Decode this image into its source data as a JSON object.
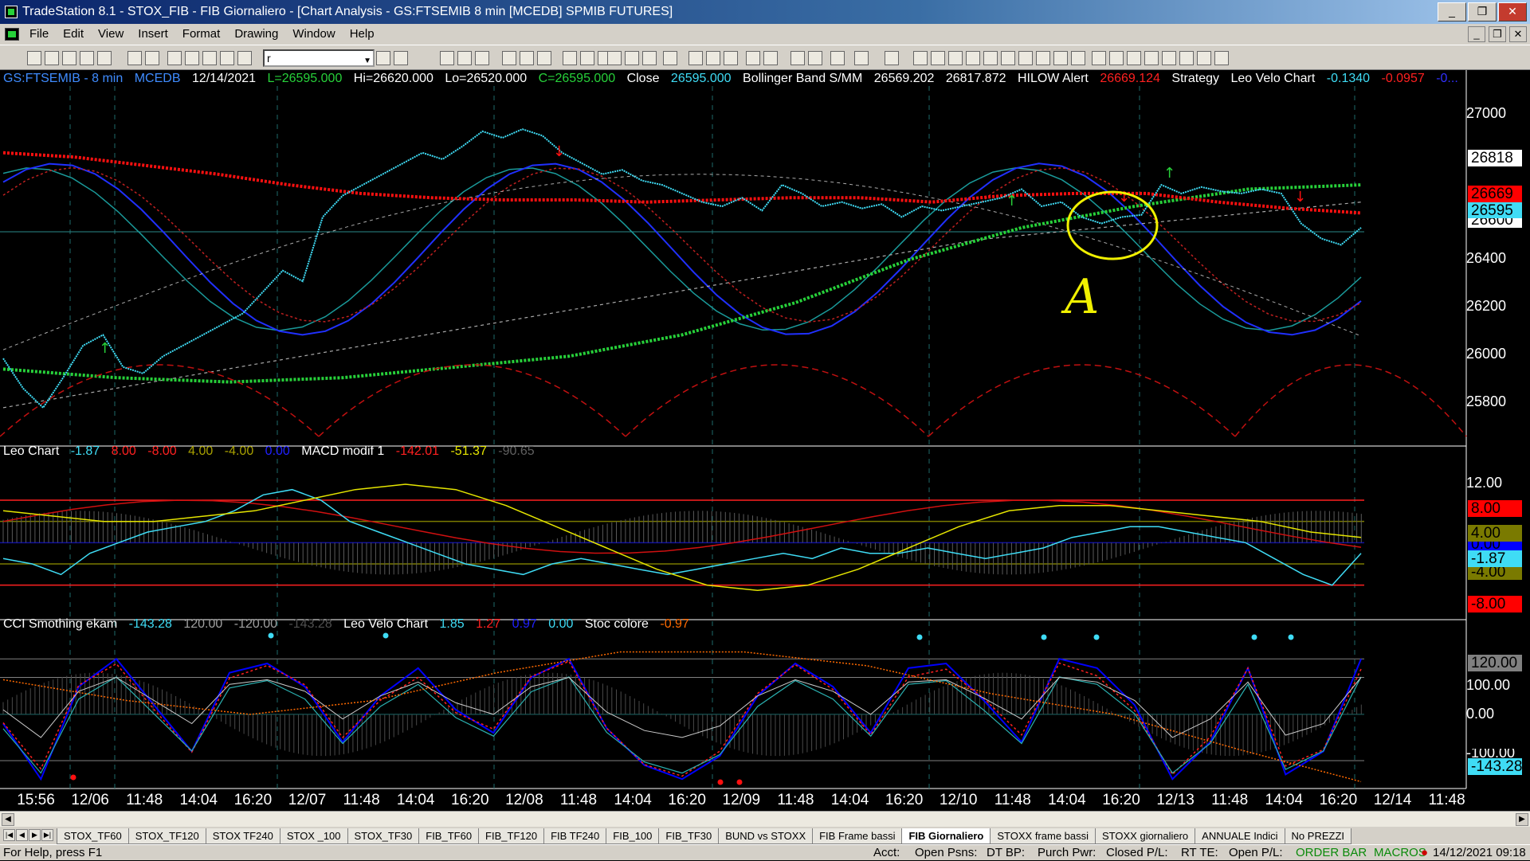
{
  "window": {
    "title": "TradeStation 8.1 - STOX_FIB - FIB Giornaliero - [Chart Analysis - GS:FTSEMIB  8 min  [MCEDB] SPMIB FUTURES]",
    "controls": [
      "_",
      "❐",
      "✕"
    ]
  },
  "menu": [
    "File",
    "Edit",
    "View",
    "Insert",
    "Format",
    "Drawing",
    "Window",
    "Help"
  ],
  "mdi_controls": [
    "_",
    "❐",
    "✕"
  ],
  "toolbar": {
    "symbol_combo_value": "r"
  },
  "panel1": {
    "symbol": "GS:FTSEMIB - 8 min",
    "source": "MCEDB",
    "date": "12/14/2021",
    "low_label": "L=26595.000",
    "high_label": "Hi=26620.000",
    "lo_label": "Lo=26520.000",
    "close_label": "C=26595.000",
    "close_word": "Close",
    "close_value": "26595.000",
    "bb_name": "Bollinger Band S/MM",
    "bb_v1": "26569.202",
    "bb_v2": "26817.872",
    "hilow_name": "HILOW Alert",
    "hilow_value": "26669.124",
    "strategy": "Strategy",
    "velo_name": "Leo Velo Chart",
    "velo_v1": "-0.1340",
    "velo_v2": "-0.0957",
    "velo_more": "-0...",
    "scale": [
      "27000",
      "26400",
      "26200",
      "26000",
      "25800"
    ],
    "badges": [
      {
        "text": "26818",
        "bg": "#ffffff",
        "fg": "#000000"
      },
      {
        "text": "26669",
        "bg": "#ff0000",
        "fg": "#000000"
      },
      {
        "text": "26595",
        "bg": "#3fdcf5",
        "fg": "#000000"
      },
      {
        "text": "26600",
        "bg": "#ffffff",
        "fg": "#000000"
      }
    ],
    "annotation": "A"
  },
  "panel2": {
    "name": "Leo Chart",
    "v1": "-1.87",
    "v2": "8.00",
    "v3": "-8.00",
    "v4": "4.00",
    "v5": "-4.00",
    "v6": "0.00",
    "macd_name": "MACD modif 1",
    "m1": "-142.01",
    "m2": "-51.37",
    "m3": "-90.65",
    "scale": [
      "12.00"
    ],
    "badges": [
      {
        "text": "8.00",
        "bg": "#ff0000",
        "fg": "#000000"
      },
      {
        "text": "4.00",
        "bg": "#7a7a00",
        "fg": "#000000"
      },
      {
        "text": "0.00",
        "bg": "#0000ff",
        "fg": "#000000"
      },
      {
        "text": "-1.87",
        "bg": "#3fdcf5",
        "fg": "#000000"
      },
      {
        "text": "-4.00",
        "bg": "#7a7a00",
        "fg": "#000000"
      },
      {
        "text": "-8.00",
        "bg": "#ff0000",
        "fg": "#000000"
      }
    ]
  },
  "panel3": {
    "cci_name": "CCI Smothing ekam",
    "c1": "-143.28",
    "c2": "120.00",
    "c3": "-120.00",
    "c4": "-143.28",
    "velo_name": "Leo Velo Chart",
    "v1": "1.85",
    "v2": "1.27",
    "v3": "0.97",
    "v4": "0.00",
    "stoc_name": "Stoc colore",
    "s1": "-0.97",
    "scale": [
      "100.00",
      "0.00",
      "-100.00"
    ],
    "badges": [
      {
        "text": "120.00",
        "bg": "#808080",
        "fg": "#000000"
      },
      {
        "text": "-143.28",
        "bg": "#3fdcf5",
        "fg": "#000000"
      }
    ]
  },
  "xaxis": [
    "15:56",
    "12/06",
    "11:48",
    "14:04",
    "16:20",
    "12/07",
    "11:48",
    "14:04",
    "16:20",
    "12/08",
    "11:48",
    "14:04",
    "16:20",
    "12/09",
    "11:48",
    "14:04",
    "16:20",
    "12/10",
    "11:48",
    "14:04",
    "16:20",
    "12/13",
    "11:48",
    "14:04",
    "16:20",
    "12/14",
    "11:48"
  ],
  "tabs": [
    "STOX_TF60",
    "STOX_TF120",
    "STOX TF240",
    "STOX _100",
    "STOX_TF30",
    "FIB_TF60",
    "FIB_TF120",
    "FIB TF240",
    "FIB_100",
    "FIB_TF30",
    "BUND vs STOXX",
    "FIB Frame bassi",
    "FIB Giornaliero",
    "STOXX frame bassi",
    "STOXX giornaliero",
    "ANNUALE Indici",
    "No PREZZI"
  ],
  "active_tab": "FIB Giornaliero",
  "status": {
    "help": "For Help, press F1",
    "acct": "Acct:",
    "open_psns": "Open Psns:",
    "dt_bp": "DT BP:",
    "purch_pwr": "Purch Pwr:",
    "closed_pl": "Closed P/L:",
    "rt_te": "RT TE:",
    "open_pl": "Open P/L:",
    "order_bar": "ORDER BAR",
    "macros": "MACROS",
    "datetime": "14/12/2021 09:18"
  },
  "chart_data": [
    {
      "type": "line",
      "title": "GS:FTSEMIB - 8 min",
      "ylim": [
        25700,
        27150
      ],
      "series": [
        {
          "name": "Close",
          "color": "#3fdcf5",
          "values": [
            25990,
            25850,
            25760,
            25900,
            26050,
            26100,
            25950,
            25920,
            26000,
            26050,
            26100,
            26150,
            26200,
            26300,
            26400,
            26350,
            26650,
            26750,
            26800,
            26850,
            26900,
            26950,
            26920,
            26980,
            27050,
            27020,
            27060,
            27030,
            26950,
            26900,
            26850,
            26870,
            26820,
            26800,
            26760,
            26720,
            26700,
            26740,
            26680,
            26800,
            26760,
            26700,
            26720,
            26690,
            26710,
            26650,
            26700,
            26680,
            26700,
            26720,
            26740,
            26780,
            26700,
            26720,
            26650,
            26620,
            26650,
            26660,
            26800,
            26760,
            26790,
            26770,
            26760,
            26780,
            26760,
            26620,
            26550,
            26520,
            26600
          ]
        }
      ]
    },
    {
      "type": "line",
      "title": "Leo Chart / MACD modif 1",
      "ylim": [
        -10,
        14
      ],
      "series": [
        {
          "name": "Leo Chart",
          "color": "#3fdcf5",
          "values": [
            -3,
            -4,
            -6,
            -2,
            0,
            2,
            3,
            4,
            6,
            9,
            10,
            8,
            4,
            2,
            0,
            -2,
            -4,
            -5,
            -6,
            -4,
            -3,
            -4,
            -5,
            -6,
            -5,
            -4,
            -3,
            -2,
            -3,
            -1,
            -2,
            -2,
            -1,
            -2,
            -3,
            -2,
            -1,
            1,
            2,
            3,
            3,
            2,
            1,
            0,
            -3,
            -6,
            -8,
            -2
          ]
        },
        {
          "name": "MACD modif 1",
          "color": "#e5e500",
          "values": [
            6,
            5,
            4,
            4,
            5,
            6,
            8,
            10,
            11,
            10,
            7,
            3,
            -1,
            -5,
            -8,
            -9,
            -8,
            -5,
            -1,
            3,
            6,
            7,
            7,
            6,
            5,
            4,
            2,
            1
          ]
        }
      ]
    },
    {
      "type": "line",
      "title": "CCI Smothing ekam / Leo Velo Chart / Stoc colore",
      "ylim": [
        -150,
        160
      ],
      "series": [
        {
          "name": "CCI Smothing ekam",
          "color": "#0000ff",
          "values": [
            -20,
            -140,
            60,
            120,
            20,
            -80,
            90,
            110,
            60,
            -60,
            40,
            100,
            10,
            -40,
            80,
            120,
            -30,
            -110,
            -140,
            -90,
            40,
            110,
            60,
            -40,
            100,
            110,
            30,
            -60,
            120,
            100,
            20,
            -140,
            -60,
            100,
            -130,
            -80,
            120
          ]
        },
        {
          "name": "Stoc colore",
          "color": "#ff6a00",
          "values": [
            0.5,
            0.2,
            0.0,
            0.2,
            0.6,
            0.9,
            0.9,
            0.7,
            0.3,
            0.0,
            -0.5,
            -0.97
          ]
        }
      ]
    }
  ]
}
